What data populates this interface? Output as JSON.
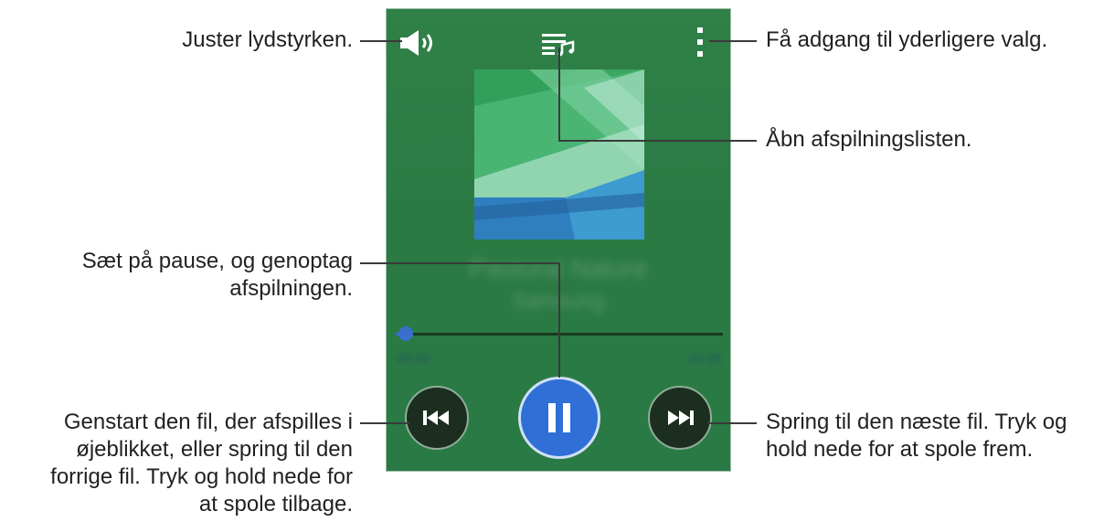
{
  "labels": {
    "volume": "Juster lydstyrken.",
    "more": "Få adgang til yderligere valg.",
    "playlist": "Åbn afspilningslisten.",
    "pause_line1": "Sæt på pause, og genoptag",
    "pause_line2": "afspilningen.",
    "prev_line1": "Genstart den fil, der afspilles i",
    "prev_line2": "øjeblikket, eller spring til den",
    "prev_line3": "forrige fil. Tryk og hold nede for",
    "prev_line4": "at spole tilbage.",
    "next_line1": "Spring til den næste fil. Tryk og",
    "next_line2": "hold nede for at spole frem."
  },
  "player": {
    "song_title": "Pastoral Nature",
    "artist": "Samsung",
    "elapsed": "00:00",
    "total": "02:29",
    "progress": 0.03
  },
  "colors": {
    "background": "#2b7a44",
    "accent": "#2f6fd6"
  },
  "icons": {
    "volume": "speaker-icon",
    "playlist": "playlist-icon",
    "more": "more-vertical-icon",
    "prev": "skip-previous-icon",
    "play": "pause-icon",
    "next": "skip-next-icon"
  }
}
